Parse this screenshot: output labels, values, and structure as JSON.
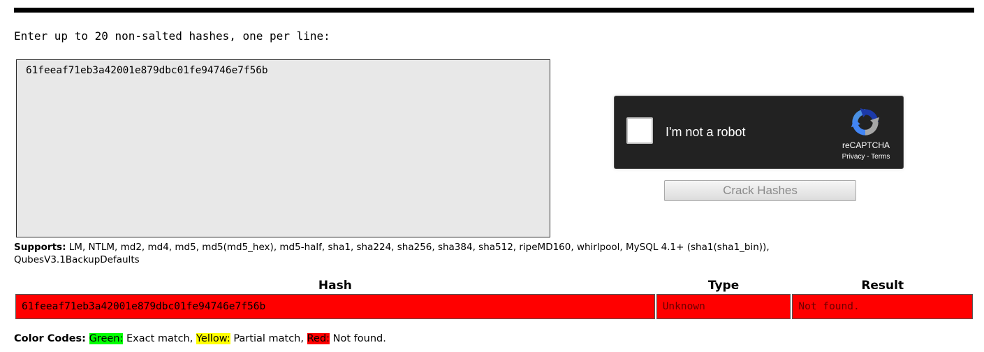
{
  "form": {
    "prompt": "Enter up to 20 non-salted hashes, one per line:",
    "hash_input_value": "61feeaf71eb3a42001e879dbc01fe94746e7f56b",
    "crack_button_label": "Crack Hashes"
  },
  "recaptcha": {
    "checkbox_label": "I'm not a robot",
    "brand": "reCAPTCHA",
    "privacy_link": "Privacy",
    "separator": " - ",
    "terms_link": "Terms",
    "logo_icon": "recaptcha-logo-icon"
  },
  "supports": {
    "label": "Supports:",
    "text": " LM, NTLM, md2, md4, md5, md5(md5_hex), md5-half, sha1, sha224, sha256, sha384, sha512, ripeMD160, whirlpool, MySQL 4.1+ (sha1(sha1_bin)), QubesV3.1BackupDefaults"
  },
  "results": {
    "headers": {
      "hash": "Hash",
      "type": "Type",
      "result": "Result"
    },
    "rows": [
      {
        "hash": "61feeaf71eb3a42001e879dbc01fe94746e7f56b",
        "type": "Unknown",
        "result": "Not found.",
        "status_color": "#ff0000"
      }
    ]
  },
  "color_codes": {
    "label": "Color Codes:",
    "green": {
      "key": "Green:",
      "desc": " Exact match,",
      "color": "#00ff00"
    },
    "yellow": {
      "key": "Yellow:",
      "desc": " Partial match,",
      "color": "#ffff00"
    },
    "red": {
      "key": "Red:",
      "desc": " Not found.",
      "color": "#ff0000"
    }
  }
}
